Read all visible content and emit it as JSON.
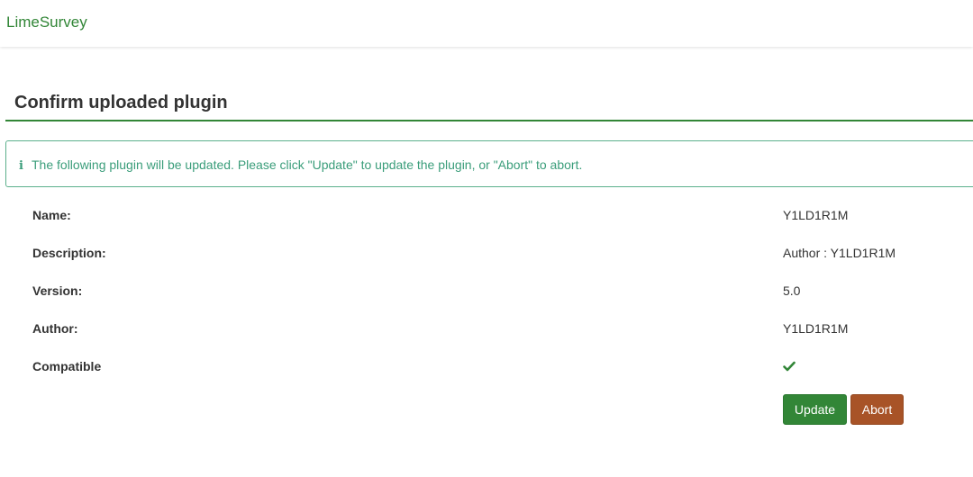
{
  "navbar": {
    "brand": "LimeSurvey"
  },
  "page": {
    "title": "Confirm uploaded plugin"
  },
  "alert": {
    "icon": "info-icon",
    "message": "The following plugin will be updated. Please click \"Update\" to update the plugin, or \"Abort\" to abort."
  },
  "details": [
    {
      "label": "Name:",
      "value": "Y1LD1R1M"
    },
    {
      "label": "Description:",
      "value": "Author : Y1LD1R1M"
    },
    {
      "label": "Version:",
      "value": "5.0"
    },
    {
      "label": "Author:",
      "value": "Y1LD1R1M"
    },
    {
      "label": "Compatible",
      "value_icon": "check-icon"
    }
  ],
  "actions": {
    "update_label": "Update",
    "abort_label": "Abort"
  },
  "colors": {
    "brand": "#328637",
    "alert_text": "#3a9d7a",
    "update_button": "#328637",
    "abort_button": "#a85327"
  }
}
